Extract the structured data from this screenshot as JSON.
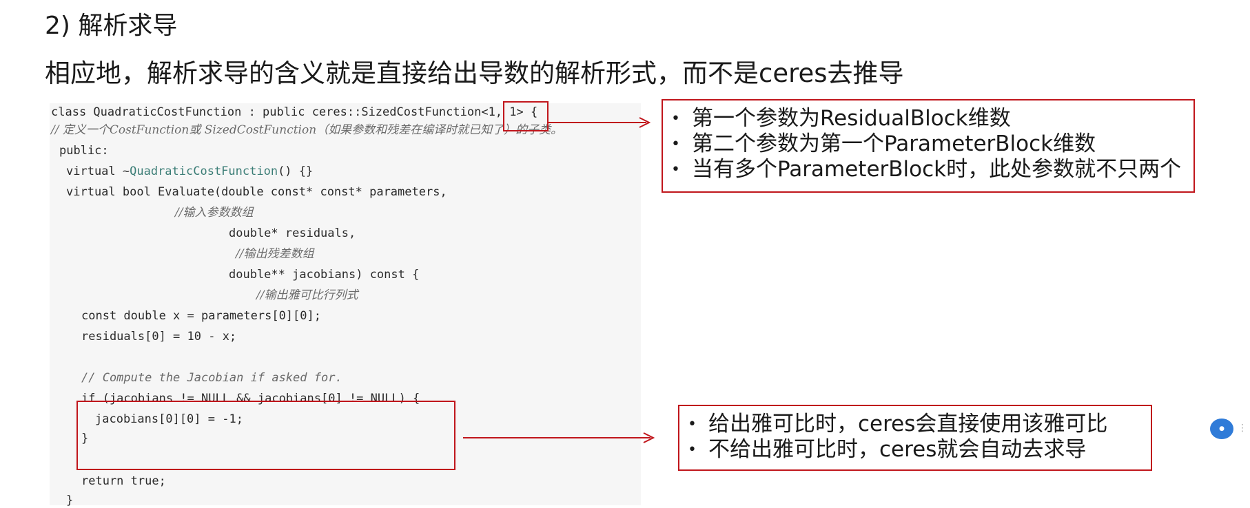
{
  "heading": "2) 解析求导",
  "subtitle": "相应地，解析求导的含义就是直接给出导数的解析形式，而不是ceres去推导",
  "code": {
    "l1_a": "class QuadraticCostFunction : public ceres::SizedCostFunction",
    "l1_b": "<1, 1>",
    "l1_c": " {",
    "l2_a": "// 定义一个",
    "l2_b": "CostFunction",
    "l2_c": "或 ",
    "l2_d": "SizedCostFunction",
    "l2_e": "（如果参数和残差在编译时就已知了）的子类。",
    "l3": "public:",
    "l4_a": "virtual ~",
    "l4_b": "QuadraticCostFunction",
    "l4_c": "() {}",
    "l5": "virtual bool Evaluate(double const* const* parameters,",
    "l6": "//输入参数数组",
    "l7": "double* residuals,",
    "l8": "//输出残差数组",
    "l9": "double** jacobians) const {",
    "l10": "//输出雅可比行列式",
    "l11": "const double x = parameters[0][0];",
    "l12": "residuals[0] = 10 - x;",
    "l13": "// Compute the Jacobian if asked for.",
    "l14": "if (jacobians != NULL && jacobians[0] != NULL) {",
    "l15": "jacobians[0][0] = -1;",
    "l16": "}",
    "l17": "return true;",
    "l18": "}"
  },
  "note_top": [
    "第一个参数为ResidualBlock维数",
    "第二个参数为第一个ParameterBlock维数",
    "当有多个ParameterBlock时，此处参数就不只两个"
  ],
  "note_bottom": [
    "给出雅可比时，ceres会直接使用该雅可比",
    "不给出雅可比时，ceres就会自动去求导"
  ],
  "bullet": "•",
  "colors": {
    "accent_red": "#c0151b",
    "code_bg": "#f6f6f6",
    "ident_teal": "#3b7d76",
    "bubble_blue": "#2f7bd8"
  },
  "icons": {
    "corner_badge": "user-avatar-bubble-icon"
  }
}
